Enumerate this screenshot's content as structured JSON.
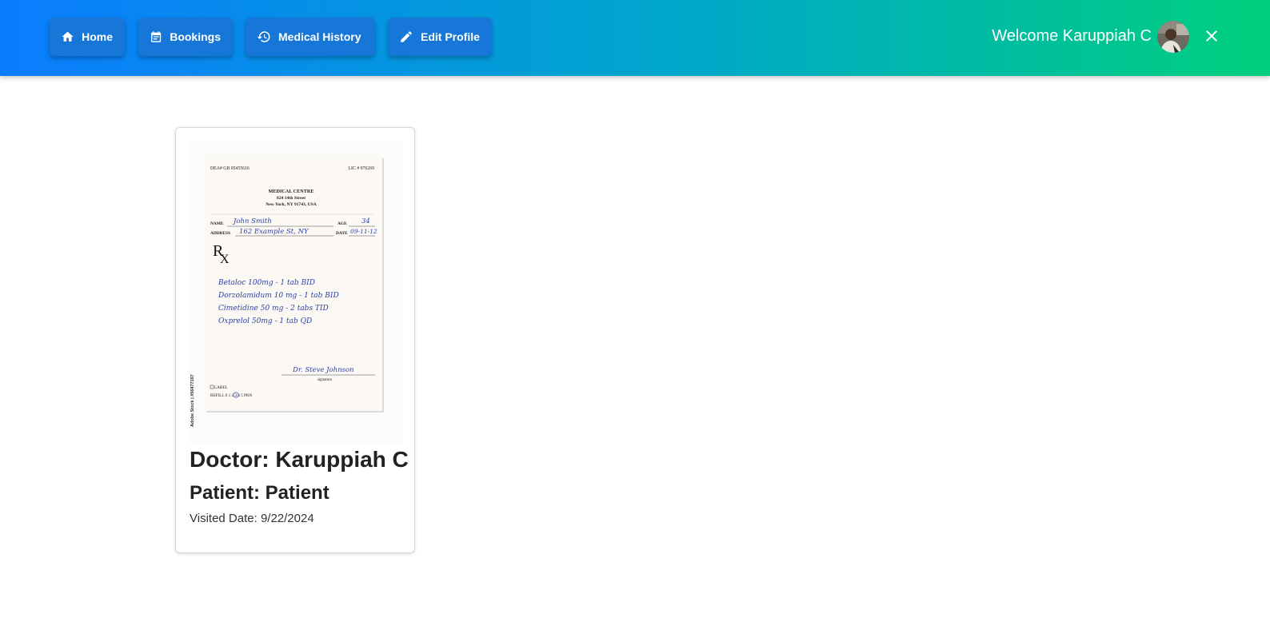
{
  "nav": {
    "items": [
      {
        "label": "Home",
        "icon": "home-icon"
      },
      {
        "label": "Bookings",
        "icon": "calendar-icon"
      },
      {
        "label": "Medical History",
        "icon": "history-icon"
      },
      {
        "label": "Edit Profile",
        "icon": "pencil-icon"
      }
    ]
  },
  "user": {
    "welcome": "Welcome Karuppiah C"
  },
  "card": {
    "title": "Doctor: Karuppiah C",
    "patient": "Patient: Patient",
    "visited": "Visited Date: 9/22/2024",
    "prescription": {
      "dea": "DEA# GB 05455616",
      "lic": "LIC # 976269",
      "clinic": "MEDICAL CENTRE",
      "street": "824 14th Street",
      "city": "New York, NY 91743, USA",
      "name_label": "NAME",
      "name": "John Smith",
      "age_label": "AGE",
      "age": "34",
      "address_label": "ADDRESS",
      "address": "162 Example St, NY",
      "date_label": "DATE",
      "date": "09-11-12",
      "rx": "R",
      "rx2": "X",
      "lines": [
        "Betaloc 100mg - 1 tab BID",
        "Dorzolamidum 10 mg - 1 tab BID",
        "Cimetidine 50 mg - 2 tabs TID",
        "Oxprelol 50mg - 1 tab QD"
      ],
      "signature": "Dr. Steve Johnson",
      "signature_label": "signature",
      "label_box": "LABEL",
      "refill": "REFILL 0 1 2 3 4 5 PRN",
      "stock": "Adobe Stock | #56477167"
    }
  },
  "colors": {
    "gradient_start": "#0a7cff",
    "gradient_end": "#00d07d",
    "button_bg": "#1677d8",
    "ink_blue": "#2a3fa8"
  }
}
